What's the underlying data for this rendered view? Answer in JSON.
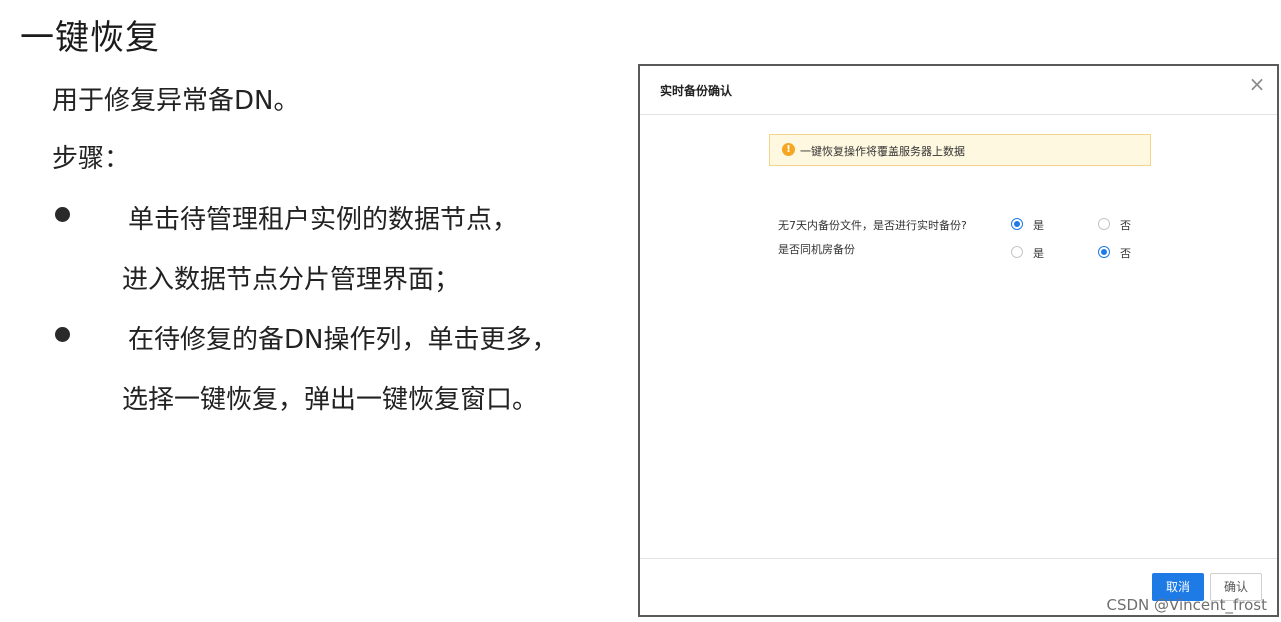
{
  "slide": {
    "title": "一键恢复",
    "intro": "用于修复异常备DN。",
    "steps_label": "步骤：",
    "step1_line1": "单击待管理租户实例的数据节点，",
    "step1_line2": "进入数据节点分片管理界面；",
    "step2_line1": "在待修复的备DN操作列，单击更多，",
    "step2_line2": "选择一键恢复，弹出一键恢复窗口。"
  },
  "dialog": {
    "title": "实时备份确认",
    "close_icon": "close-icon",
    "warning": "一键恢复操作将覆盖服务器上数据",
    "question1": {
      "label": "无7天内备份文件，是否进行实时备份?",
      "yes": "是",
      "no": "否",
      "selected": "是"
    },
    "question2": {
      "label": "是否同机房备份",
      "yes": "是",
      "no": "否",
      "selected": "否"
    },
    "cancel_label": "取消",
    "confirm_label": "确认"
  },
  "colors": {
    "primary": "#1e7be6",
    "warning_bg": "#fff8e1",
    "warning_icon": "#f5a623"
  },
  "watermark": "CSDN @Vincent_frost"
}
